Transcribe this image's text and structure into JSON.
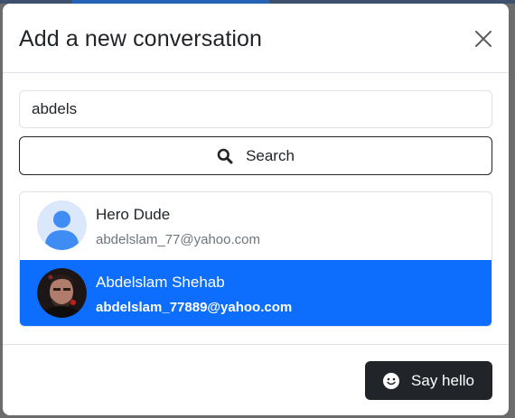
{
  "modal": {
    "title": "Add a new conversation",
    "close_icon": "close-icon"
  },
  "search": {
    "value": "abdels",
    "placeholder": "",
    "button_label": "Search",
    "button_icon": "search-icon"
  },
  "results": [
    {
      "name": "Hero Dude",
      "email": "abdelslam_77@yahoo.com",
      "avatar": "default-user-avatar",
      "selected": false
    },
    {
      "name": "Abdelslam Shehab",
      "email": "abdelslam_77889@yahoo.com",
      "avatar": "user-photo-avatar",
      "selected": true
    }
  ],
  "footer": {
    "hello_label": "Say hello",
    "hello_icon": "smile-icon"
  },
  "colors": {
    "primary": "#0d6efd",
    "dark": "#212529",
    "muted": "#6c757d",
    "border": "#dee2e6"
  }
}
